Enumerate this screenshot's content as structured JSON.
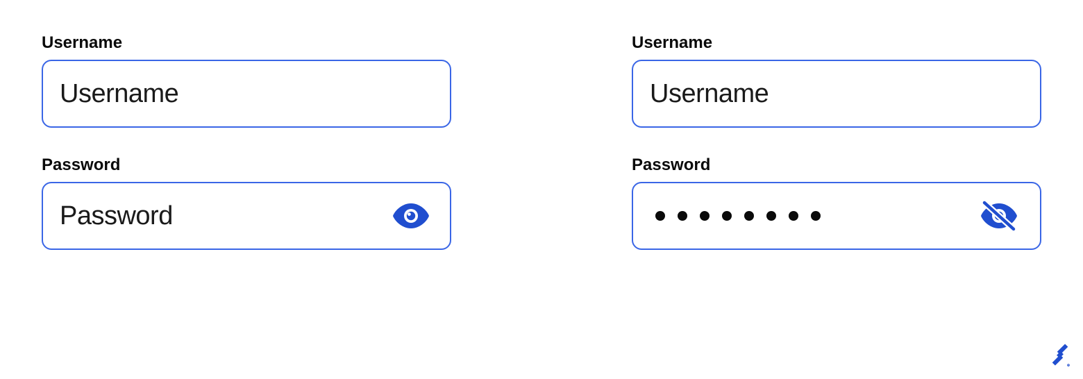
{
  "colors": {
    "border": "#3a66e6",
    "brand": "#204ECF",
    "text": "#0a0a0a"
  },
  "left": {
    "username": {
      "label": "Username",
      "value": "Username"
    },
    "password": {
      "label": "Password",
      "value": "Password",
      "masked": false
    }
  },
  "right": {
    "username": {
      "label": "Username",
      "value": "Username"
    },
    "password": {
      "label": "Password",
      "value": "••••••••",
      "dot_count": 8,
      "masked": true
    }
  },
  "icons": {
    "show": "eye-icon",
    "hide": "eye-slash-icon"
  },
  "brand": {
    "name": "toptal-logo"
  }
}
